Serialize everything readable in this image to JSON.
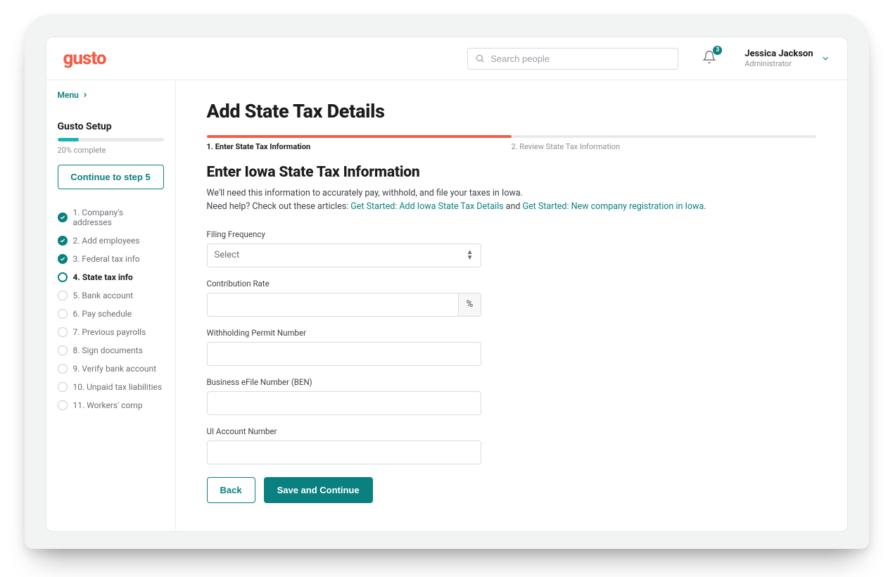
{
  "header": {
    "logo": "gusto",
    "search_placeholder": "Search people",
    "notification_count": "3",
    "user_name": "Jessica Jackson",
    "user_role": "Administrator"
  },
  "sidebar": {
    "menu_label": "Menu",
    "setup_title": "Gusto Setup",
    "progress_percent": 20,
    "progress_label": "20% complete",
    "continue_label": "Continue to step 5",
    "steps": [
      {
        "label": "1. Company's addresses",
        "state": "done"
      },
      {
        "label": "2. Add employees",
        "state": "done"
      },
      {
        "label": "3. Federal tax info",
        "state": "done"
      },
      {
        "label": "4. State tax info",
        "state": "current"
      },
      {
        "label": "5. Bank account",
        "state": "pending"
      },
      {
        "label": "6. Pay schedule",
        "state": "pending"
      },
      {
        "label": "7. Previous payrolls",
        "state": "pending"
      },
      {
        "label": "8. Sign documents",
        "state": "pending"
      },
      {
        "label": "9. Verify bank account",
        "state": "pending"
      },
      {
        "label": "10. Unpaid tax liabilities",
        "state": "pending"
      },
      {
        "label": "11. Workers' comp",
        "state": "pending"
      }
    ]
  },
  "main": {
    "page_title": "Add State Tax Details",
    "tabs": [
      {
        "label": "1. Enter State Tax Information",
        "active": true
      },
      {
        "label": "2. Review State Tax Information",
        "active": false
      }
    ],
    "section_title": "Enter Iowa State Tax Information",
    "intro_line": "We'll need this information to accurately pay, withhold, and file your taxes in Iowa.",
    "help_prefix": "Need help? Check out these articles: ",
    "help_link1": "Get Started: Add Iowa State Tax Details",
    "help_sep": " and ",
    "help_link2": "Get Started: New company registration in Iowa",
    "help_suffix": ".",
    "fields": {
      "filing_frequency_label": "Filing Frequency",
      "filing_frequency_placeholder": "Select",
      "contribution_rate_label": "Contribution Rate",
      "contribution_rate_suffix": "%",
      "withholding_label": "Withholding Permit Number",
      "ben_label": "Business eFile Number (BEN)",
      "ui_label": "UI Account Number"
    },
    "buttons": {
      "back": "Back",
      "save": "Save and Continue"
    }
  }
}
